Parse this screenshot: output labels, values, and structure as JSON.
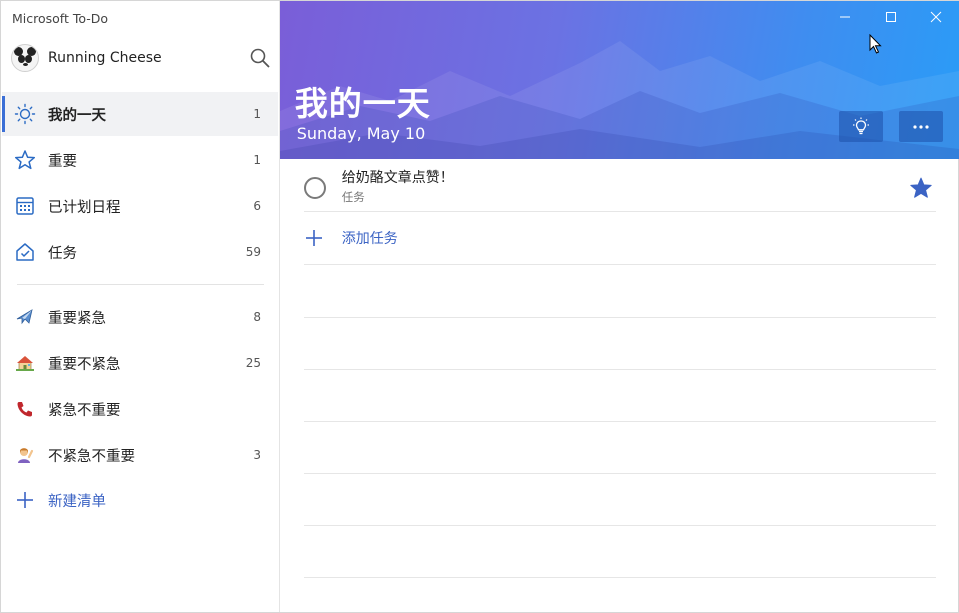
{
  "app": {
    "title": "Microsoft To-Do"
  },
  "profile": {
    "name": "Running Cheese"
  },
  "sidebar": {
    "items": [
      {
        "label": "我的一天",
        "count": "1",
        "icon": "sun-icon",
        "active": true
      },
      {
        "label": "重要",
        "count": "1",
        "icon": "star-icon"
      },
      {
        "label": "已计划日程",
        "count": "6",
        "icon": "calendar-icon"
      },
      {
        "label": "任务",
        "count": "59",
        "icon": "home-icon"
      }
    ],
    "lists": [
      {
        "label": "重要紧急",
        "count": "8",
        "icon": "airplane-emoji-icon"
      },
      {
        "label": "重要不紧急",
        "count": "25",
        "icon": "house-emoji-icon"
      },
      {
        "label": "紧急不重要",
        "count": "",
        "icon": "telephone-emoji-icon"
      },
      {
        "label": "不紧急不重要",
        "count": "3",
        "icon": "person-emoji-icon"
      }
    ],
    "new_list_label": "新建清单"
  },
  "header": {
    "title": "我的一天",
    "date": "Sunday, May 10",
    "accent": "#3b6fd6"
  },
  "tasks": [
    {
      "title": "给奶酪文章点赞！",
      "subtitle": "任务",
      "starred": true
    }
  ],
  "add_task_label": "添加任务",
  "colors": {
    "link": "#3b63c4",
    "star": "#3b63c4"
  }
}
